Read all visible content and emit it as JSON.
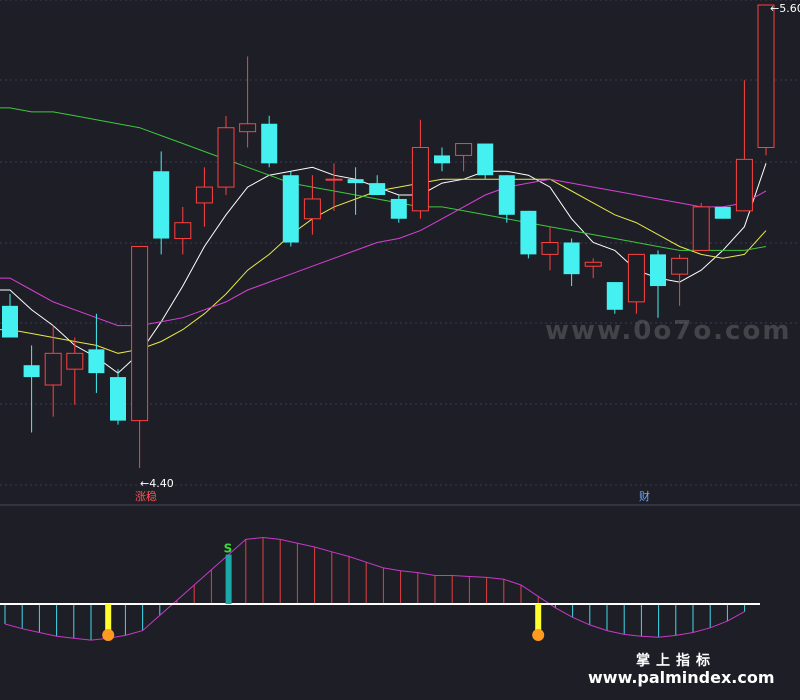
{
  "chart_data": {
    "type": "candlestick",
    "price_scale": {
      "min": 4.4,
      "max": 5.6
    },
    "candles": [
      {
        "o": 4.84,
        "c": 4.76,
        "h": 4.87,
        "l": 4.77
      },
      {
        "o": 4.69,
        "c": 4.66,
        "h": 4.74,
        "l": 4.52
      },
      {
        "o": 4.64,
        "c": 4.72,
        "h": 4.79,
        "l": 4.56
      },
      {
        "o": 4.68,
        "c": 4.72,
        "h": 4.76,
        "l": 4.59
      },
      {
        "o": 4.73,
        "c": 4.67,
        "h": 4.82,
        "l": 4.62
      },
      {
        "o": 4.66,
        "c": 4.55,
        "h": 4.68,
        "l": 4.54
      },
      {
        "o": 4.55,
        "c": 4.99,
        "h": 4.99,
        "l": 4.43
      },
      {
        "o": 5.18,
        "c": 5.01,
        "h": 5.23,
        "l": 4.97
      },
      {
        "o": 5.01,
        "c": 5.05,
        "h": 5.09,
        "l": 4.97
      },
      {
        "o": 5.1,
        "c": 5.14,
        "h": 5.19,
        "l": 5.04
      },
      {
        "o": 5.14,
        "c": 5.29,
        "h": 5.32,
        "l": 5.12
      },
      {
        "o": 5.28,
        "c": 5.3,
        "h": 5.47,
        "l": 5.24
      },
      {
        "o": 5.3,
        "c": 5.2,
        "h": 5.32,
        "l": 5.19
      },
      {
        "o": 5.17,
        "c": 5.0,
        "h": 5.18,
        "l": 4.99
      },
      {
        "o": 5.06,
        "c": 5.11,
        "h": 5.17,
        "l": 5.02
      },
      {
        "o": 5.16,
        "c": 5.16,
        "h": 5.2,
        "l": 5.08
      },
      {
        "o": 5.16,
        "c": 5.15,
        "h": 5.19,
        "l": 5.07
      },
      {
        "o": 5.15,
        "c": 5.12,
        "h": 5.17,
        "l": 5.12
      },
      {
        "o": 5.11,
        "c": 5.06,
        "h": 5.12,
        "l": 5.05
      },
      {
        "o": 5.08,
        "c": 5.24,
        "h": 5.31,
        "l": 5.06
      },
      {
        "o": 5.22,
        "c": 5.2,
        "h": 5.24,
        "l": 5.18
      },
      {
        "o": 5.22,
        "c": 5.25,
        "h": 5.25,
        "l": 5.18
      },
      {
        "o": 5.25,
        "c": 5.17,
        "h": 5.25,
        "l": 5.16
      },
      {
        "o": 5.17,
        "c": 5.07,
        "h": 5.17,
        "l": 5.05
      },
      {
        "o": 5.08,
        "c": 4.97,
        "h": 5.08,
        "l": 4.96
      },
      {
        "o": 4.97,
        "c": 5.0,
        "h": 5.04,
        "l": 4.93
      },
      {
        "o": 5.0,
        "c": 4.92,
        "h": 5.01,
        "l": 4.89
      },
      {
        "o": 4.94,
        "c": 4.95,
        "h": 4.96,
        "l": 4.91
      },
      {
        "o": 4.9,
        "c": 4.83,
        "h": 4.9,
        "l": 4.82
      },
      {
        "o": 4.85,
        "c": 4.97,
        "h": 4.97,
        "l": 4.82
      },
      {
        "o": 4.97,
        "c": 4.89,
        "h": 4.98,
        "l": 4.81
      },
      {
        "o": 4.92,
        "c": 4.96,
        "h": 4.97,
        "l": 4.84
      },
      {
        "o": 4.98,
        "c": 5.09,
        "h": 5.1,
        "l": 4.98
      },
      {
        "o": 5.09,
        "c": 5.06,
        "h": 5.09,
        "l": 5.06
      },
      {
        "o": 5.08,
        "c": 5.21,
        "h": 5.41,
        "l": 5.08
      },
      {
        "o": 5.24,
        "c": 5.6,
        "h": 5.6,
        "l": 5.22
      }
    ],
    "ma_lines": [
      {
        "name": "MA5",
        "color": "#ffffff",
        "values": [
          4.88,
          4.83,
          4.79,
          4.74,
          4.71,
          4.67,
          4.72,
          4.8,
          4.89,
          4.99,
          5.07,
          5.14,
          5.17,
          5.18,
          5.19,
          5.17,
          5.16,
          5.14,
          5.12,
          5.12,
          5.15,
          5.16,
          5.18,
          5.18,
          5.17,
          5.14,
          5.06,
          5.0,
          4.98,
          4.93,
          4.91,
          4.9,
          4.93,
          4.98,
          5.04,
          5.2
        ]
      },
      {
        "name": "MA10",
        "color": "#e8e84a",
        "values": [
          4.78,
          4.77,
          4.76,
          4.75,
          4.74,
          4.72,
          4.73,
          4.75,
          4.78,
          4.82,
          4.87,
          4.93,
          4.97,
          5.02,
          5.06,
          5.09,
          5.11,
          5.13,
          5.14,
          5.15,
          5.16,
          5.16,
          5.16,
          5.16,
          5.16,
          5.16,
          5.13,
          5.1,
          5.07,
          5.05,
          5.02,
          4.99,
          4.97,
          4.96,
          4.97,
          5.03
        ]
      },
      {
        "name": "MA20",
        "color": "#d840d8",
        "values": [
          4.91,
          4.88,
          4.85,
          4.83,
          4.81,
          4.79,
          4.79,
          4.8,
          4.81,
          4.83,
          4.85,
          4.88,
          4.9,
          4.92,
          4.94,
          4.96,
          4.98,
          5.0,
          5.01,
          5.03,
          5.06,
          5.09,
          5.12,
          5.14,
          5.15,
          5.16,
          5.15,
          5.14,
          5.13,
          5.12,
          5.11,
          5.1,
          5.09,
          5.09,
          5.1,
          5.13
        ]
      },
      {
        "name": "MA60",
        "color": "#3cc83c",
        "values": [
          5.34,
          5.33,
          5.33,
          5.32,
          5.31,
          5.3,
          5.29,
          5.27,
          5.25,
          5.23,
          5.21,
          5.19,
          5.17,
          5.15,
          5.14,
          5.13,
          5.12,
          5.11,
          5.1,
          5.09,
          5.09,
          5.08,
          5.07,
          5.06,
          5.05,
          5.04,
          5.03,
          5.02,
          5.01,
          5.0,
          4.99,
          4.98,
          4.98,
          4.98,
          4.98,
          4.99
        ]
      }
    ],
    "annotations": {
      "low_label": "4.40",
      "high_label": "5.60",
      "tag_limit_up": "涨稳",
      "tag_finance": "财"
    },
    "indicator": {
      "type": "histogram",
      "values": [
        -0.21,
        -0.26,
        -0.3,
        -0.34,
        -0.36,
        -0.38,
        -0.36,
        -0.33,
        -0.28,
        -0.12,
        0.04,
        0.2,
        0.36,
        0.52,
        0.68,
        0.7,
        0.68,
        0.64,
        0.6,
        0.55,
        0.5,
        0.44,
        0.38,
        0.35,
        0.33,
        0.3,
        0.3,
        0.29,
        0.28,
        0.26,
        0.2,
        0.08,
        -0.04,
        -0.14,
        -0.22,
        -0.28,
        -0.32,
        -0.34,
        -0.35,
        -0.33,
        -0.3,
        -0.25,
        -0.18,
        -0.08
      ],
      "marker_text": "S",
      "signal_bar_indices": [
        6,
        13,
        31
      ]
    },
    "colors": {
      "background": "#1e1f26",
      "up": "#ff4040",
      "down": "#44f0f0",
      "grid": "#3a3a52"
    }
  },
  "watermark": {
    "cn": "掌上指标",
    "url": "www.palmindex.com",
    "mid": "www.0o7o.com"
  }
}
